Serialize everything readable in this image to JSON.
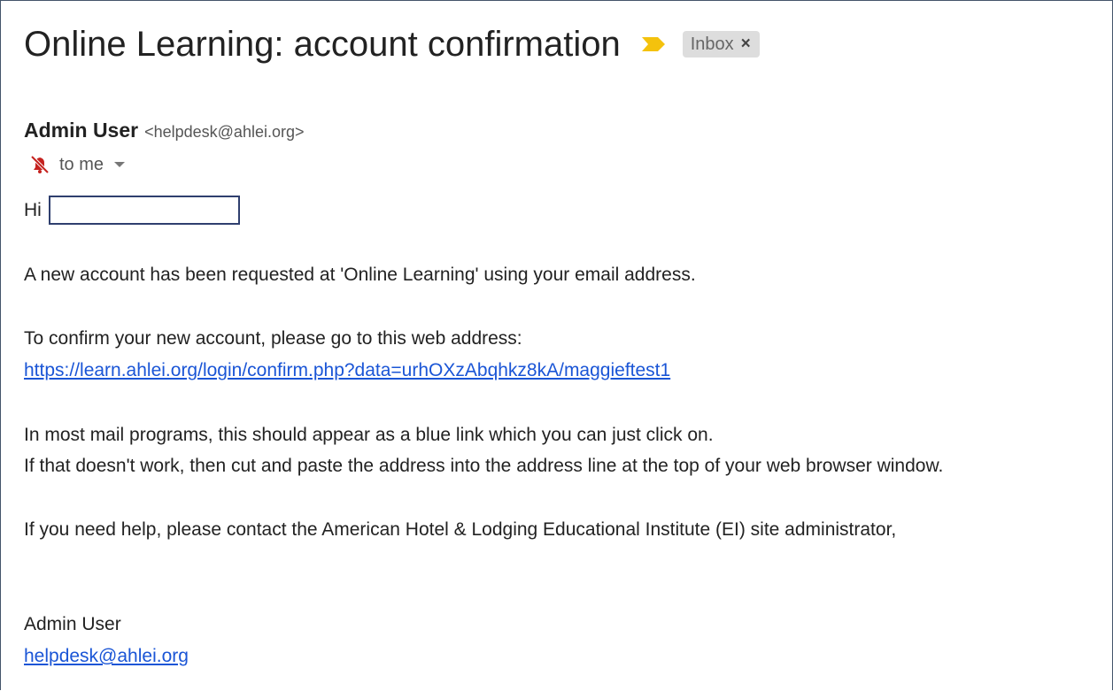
{
  "email": {
    "subject": "Online Learning: account confirmation",
    "label": "Inbox",
    "label_remove": "×",
    "sender_name": "Admin User",
    "sender_email": "<helpdesk@ahlei.org>",
    "recipient": "to me",
    "greeting": "Hi",
    "body": {
      "line1": "A new account has been requested at 'Online Learning' using your email address.",
      "line2": "To confirm your new account, please go to this web address:",
      "confirm_link": "https://learn.ahlei.org/login/confirm.php?data=urhOXzAbqhkz8kA/maggieftest1",
      "line3": "In most mail programs, this should appear as a blue link which you can just click on.",
      "line4": "If that doesn't work, then cut and paste the address into the address line at the top of your web browser window.",
      "line5": "If you need help, please contact the American Hotel & Lodging Educational Institute (EI) site administrator,"
    },
    "signature_name": "Admin User",
    "signature_email": "helpdesk@ahlei.org"
  },
  "icons": {
    "importance": "importance-marker-icon",
    "mute": "muted-bell-icon",
    "caret": "chevron-down-icon"
  },
  "colors": {
    "importance_marker": "#f4c20d",
    "link": "#1a55d6",
    "label_chip_bg": "#dddddd",
    "mute_icon": "#c5221f",
    "frame_border": "#44546a"
  }
}
